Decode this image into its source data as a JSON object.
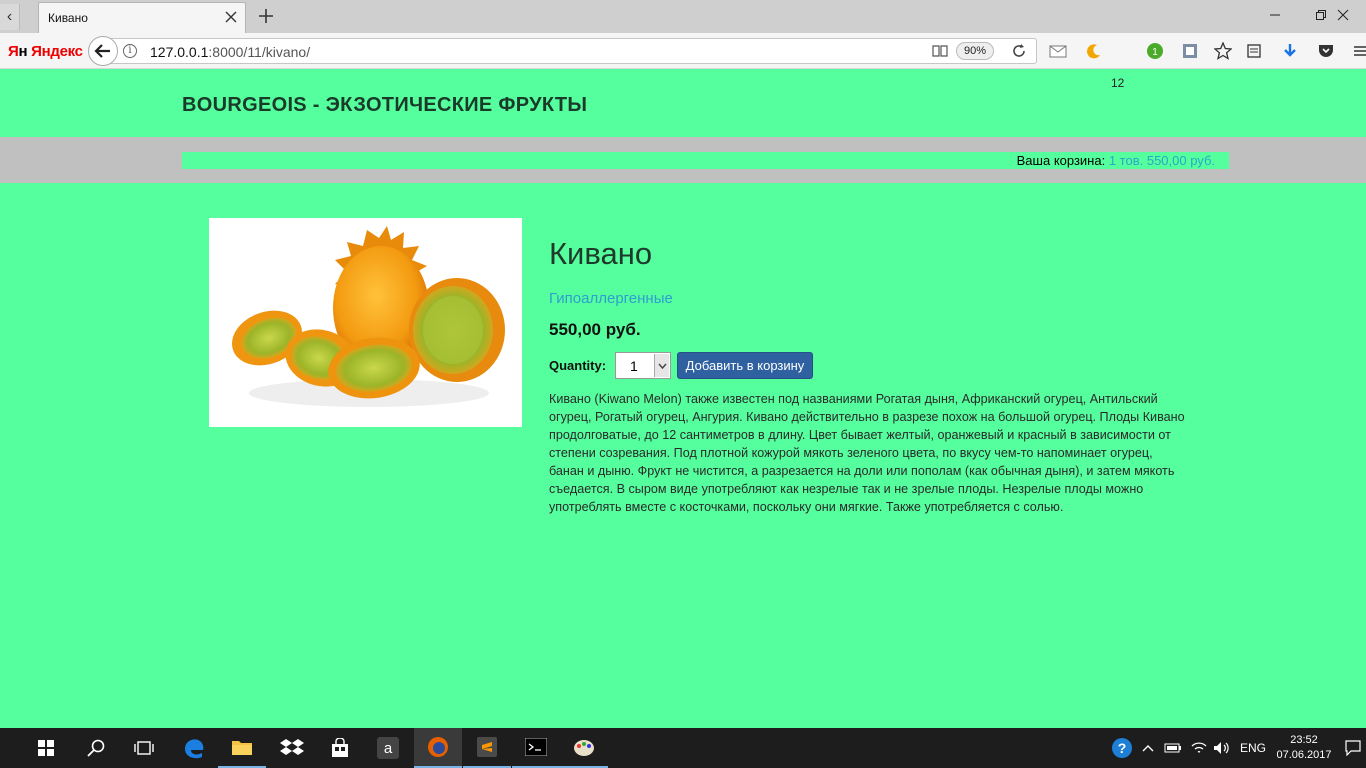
{
  "browser": {
    "tab_title": "Кивано",
    "url_host": "127.0.0.1",
    "url_rest": ":8000/11/kivano/",
    "zoom": "90%",
    "badge_count": "12",
    "yandex_logo": {
      "ya": "Я",
      "n": "н",
      "yandex": "Яндекс"
    }
  },
  "site": {
    "title": "BOURGEOIS - ЭКЗОТИЧЕСКИЕ ФРУКТЫ",
    "cart_label": "Ваша корзина:",
    "cart_summary": "1 тов. 550,00 руб."
  },
  "product": {
    "name": "Кивано",
    "category": "Гипоаллергенные",
    "price": "550,00 руб.",
    "quantity_label": "Quantity:",
    "quantity_value": "1",
    "add_button": "Добавить в корзину",
    "description": "Кивано (Kiwano Melon) также известен под названиями Рогатая дыня, Африканский огурец, Антильский огурец, Рогатый огурец, Ангурия. Кивано действительно в разрезе похож на большой огурец. Плоды Кивано продолговатые, до 12 сантиметров в длину. Цвет бывает желтый, оранжевый и красный в зависимости от степени созревания. Под плотной кожурой мякоть зеленого цвета, по вкусу чем-то напоминает огурец, банан и дыню. Фрукт не чистится, а разрезается на доли или пополам (как обычная дыня), и затем мякоть съедается. В сыром виде употребляют как незрелые так и не зрелые плоды. Незрелые плоды можно употреблять вместе с косточками, поскольку они мягкие. Также употребляется с солью."
  },
  "taskbar": {
    "language": "ENG",
    "time": "23:52",
    "date": "07.06.2017"
  },
  "colors": {
    "page_bg": "#55ff9d",
    "cartbar_bg": "#c0c0c0",
    "button_bg": "#2f61a1",
    "link": "#2e9fd0"
  }
}
